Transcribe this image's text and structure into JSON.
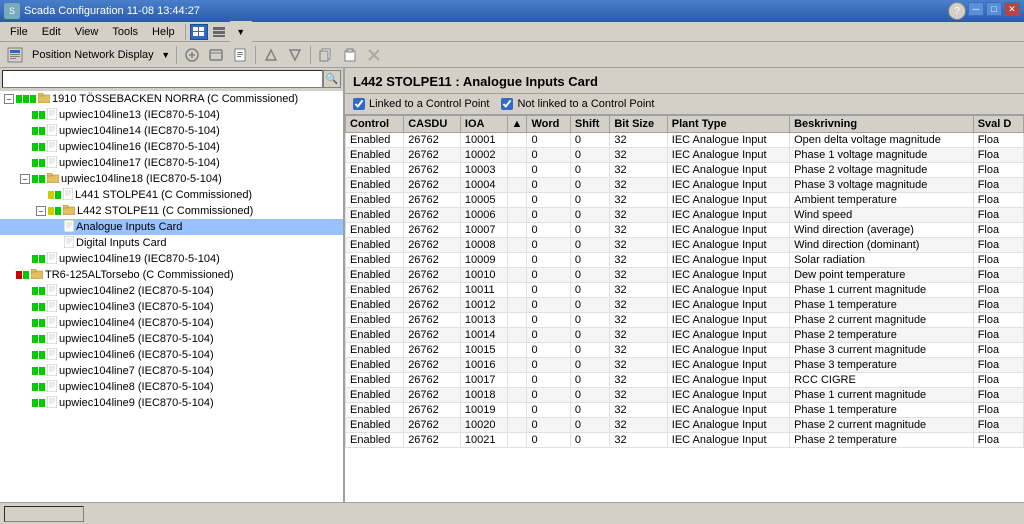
{
  "titleBar": {
    "title": "Scada Configuration  11-08 13:44:27",
    "icon": "S",
    "minimize": "─",
    "maximize": "□",
    "close": "✕",
    "help": "?"
  },
  "menuBar": {
    "items": [
      "File",
      "Edit",
      "View",
      "Tools",
      "Help"
    ]
  },
  "toolbar": {
    "networkDisplay": "Position Network Display",
    "dropdownArrow": "▼"
  },
  "leftPanel": {
    "searchPlaceholder": "",
    "treeItems": [
      {
        "level": 0,
        "label": "1910 TÖSSEBACKEN NORRA (C  Commissioned)",
        "hasExpand": true,
        "expanded": true,
        "dotColors": [
          "green",
          "green",
          "green"
        ],
        "id": "1910"
      },
      {
        "level": 1,
        "label": "upwiec104line13 (IEC870-5-104)",
        "hasExpand": false,
        "dotColors": [
          "green",
          "green"
        ],
        "id": "line13"
      },
      {
        "level": 1,
        "label": "upwiec104line14 (IEC870-5-104)",
        "hasExpand": false,
        "dotColors": [
          "green",
          "green"
        ],
        "id": "line14"
      },
      {
        "level": 1,
        "label": "upwiec104line16 (IEC870-5-104)",
        "hasExpand": false,
        "dotColors": [
          "green",
          "green"
        ],
        "id": "line16"
      },
      {
        "level": 1,
        "label": "upwiec104line17 (IEC870-5-104)",
        "hasExpand": false,
        "dotColors": [
          "green",
          "green"
        ],
        "id": "line17"
      },
      {
        "level": 1,
        "label": "upwiec104line18 (IEC870-5-104)",
        "hasExpand": true,
        "expanded": true,
        "dotColors": [
          "green",
          "green"
        ],
        "id": "line18"
      },
      {
        "level": 2,
        "label": "L441 STOLPE41 (C  Commissioned)",
        "hasExpand": false,
        "dotColors": [
          "yellow",
          "green"
        ],
        "id": "L441"
      },
      {
        "level": 2,
        "label": "L442 STOLPE11 (C  Commissioned)",
        "hasExpand": true,
        "expanded": true,
        "dotColors": [
          "yellow",
          "green"
        ],
        "id": "L442",
        "selected": false
      },
      {
        "level": 3,
        "label": "Analogue Inputs Card",
        "hasExpand": false,
        "dotColors": [],
        "id": "AnalogueInputs",
        "highlighted": true
      },
      {
        "level": 3,
        "label": "Digital Inputs Card",
        "hasExpand": false,
        "dotColors": [],
        "id": "DigitalInputs"
      },
      {
        "level": 1,
        "label": "upwiec104line19 (IEC870-5-104)",
        "hasExpand": false,
        "dotColors": [
          "green",
          "green"
        ],
        "id": "line19"
      },
      {
        "level": 0,
        "label": "TR6-125ALTorsebo (C  Commissioned)",
        "hasExpand": false,
        "dotColors": [
          "red",
          "green"
        ],
        "id": "TR6"
      },
      {
        "level": 1,
        "label": "upwiec104line2 (IEC870-5-104)",
        "hasExpand": false,
        "dotColors": [
          "green",
          "green"
        ],
        "id": "line2"
      },
      {
        "level": 1,
        "label": "upwiec104line3 (IEC870-5-104)",
        "hasExpand": false,
        "dotColors": [
          "green",
          "green"
        ],
        "id": "line3"
      },
      {
        "level": 1,
        "label": "upwiec104line4 (IEC870-5-104)",
        "hasExpand": false,
        "dotColors": [
          "green",
          "green"
        ],
        "id": "line4"
      },
      {
        "level": 1,
        "label": "upwiec104line5 (IEC870-5-104)",
        "hasExpand": false,
        "dotColors": [
          "green",
          "green"
        ],
        "id": "line5"
      },
      {
        "level": 1,
        "label": "upwiec104line6 (IEC870-5-104)",
        "hasExpand": false,
        "dotColors": [
          "green",
          "green"
        ],
        "id": "line6"
      },
      {
        "level": 1,
        "label": "upwiec104line7 (IEC870-5-104)",
        "hasExpand": false,
        "dotColors": [
          "green",
          "green"
        ],
        "id": "line7"
      },
      {
        "level": 1,
        "label": "upwiec104line8 (IEC870-5-104)",
        "hasExpand": false,
        "dotColors": [
          "green",
          "green"
        ],
        "id": "line8"
      },
      {
        "level": 1,
        "label": "upwiec104line9 (IEC870-5-104)",
        "hasExpand": false,
        "dotColors": [
          "green",
          "green"
        ],
        "id": "line9"
      }
    ]
  },
  "rightPanel": {
    "title": "L442 STOLPE11 : Analogue Inputs Card",
    "filters": [
      {
        "label": "Linked to a Control Point",
        "checked": true
      },
      {
        "label": "Not linked to a Control Point",
        "checked": true
      }
    ],
    "tableColumns": [
      "Control",
      "CASDU",
      "IOA",
      "▲",
      "Word",
      "Shift",
      "Bit Size",
      "Plant Type",
      "Beskrivning",
      "Sval D"
    ],
    "tableRows": [
      [
        "Enabled",
        "26762",
        "10001",
        "",
        "0",
        "0",
        "32",
        "IEC Analogue Input",
        "Open delta voltage magnitude",
        "Floa"
      ],
      [
        "Enabled",
        "26762",
        "10002",
        "",
        "0",
        "0",
        "32",
        "IEC Analogue Input",
        "Phase 1 voltage magnitude",
        "Floa"
      ],
      [
        "Enabled",
        "26762",
        "10003",
        "",
        "0",
        "0",
        "32",
        "IEC Analogue Input",
        "Phase 2 voltage magnitude",
        "Floa"
      ],
      [
        "Enabled",
        "26762",
        "10004",
        "",
        "0",
        "0",
        "32",
        "IEC Analogue Input",
        "Phase 3 voltage magnitude",
        "Floa"
      ],
      [
        "Enabled",
        "26762",
        "10005",
        "",
        "0",
        "0",
        "32",
        "IEC Analogue Input",
        "Ambient temperature",
        "Floa"
      ],
      [
        "Enabled",
        "26762",
        "10006",
        "",
        "0",
        "0",
        "32",
        "IEC Analogue Input",
        "Wind speed",
        "Floa"
      ],
      [
        "Enabled",
        "26762",
        "10007",
        "",
        "0",
        "0",
        "32",
        "IEC Analogue Input",
        "Wind direction (average)",
        "Floa"
      ],
      [
        "Enabled",
        "26762",
        "10008",
        "",
        "0",
        "0",
        "32",
        "IEC Analogue Input",
        "Wind direction (dominant)",
        "Floa"
      ],
      [
        "Enabled",
        "26762",
        "10009",
        "",
        "0",
        "0",
        "32",
        "IEC Analogue Input",
        "Solar radiation",
        "Floa"
      ],
      [
        "Enabled",
        "26762",
        "10010",
        "",
        "0",
        "0",
        "32",
        "IEC Analogue Input",
        "Dew point temperature",
        "Floa"
      ],
      [
        "Enabled",
        "26762",
        "10011",
        "",
        "0",
        "0",
        "32",
        "IEC Analogue Input",
        "Phase 1 current magnitude",
        "Floa"
      ],
      [
        "Enabled",
        "26762",
        "10012",
        "",
        "0",
        "0",
        "32",
        "IEC Analogue Input",
        "Phase 1 temperature",
        "Floa"
      ],
      [
        "Enabled",
        "26762",
        "10013",
        "",
        "0",
        "0",
        "32",
        "IEC Analogue Input",
        "Phase 2 current magnitude",
        "Floa"
      ],
      [
        "Enabled",
        "26762",
        "10014",
        "",
        "0",
        "0",
        "32",
        "IEC Analogue Input",
        "Phase 2 temperature",
        "Floa"
      ],
      [
        "Enabled",
        "26762",
        "10015",
        "",
        "0",
        "0",
        "32",
        "IEC Analogue Input",
        "Phase 3 current magnitude",
        "Floa"
      ],
      [
        "Enabled",
        "26762",
        "10016",
        "",
        "0",
        "0",
        "32",
        "IEC Analogue Input",
        "Phase 3 temperature",
        "Floa"
      ],
      [
        "Enabled",
        "26762",
        "10017",
        "",
        "0",
        "0",
        "32",
        "IEC Analogue Input",
        "RCC CIGRE",
        "Floa"
      ],
      [
        "Enabled",
        "26762",
        "10018",
        "",
        "0",
        "0",
        "32",
        "IEC Analogue Input",
        "Phase 1 current magnitude",
        "Floa"
      ],
      [
        "Enabled",
        "26762",
        "10019",
        "",
        "0",
        "0",
        "32",
        "IEC Analogue Input",
        "Phase 1 temperature",
        "Floa"
      ],
      [
        "Enabled",
        "26762",
        "10020",
        "",
        "0",
        "0",
        "32",
        "IEC Analogue Input",
        "Phase 2 current magnitude",
        "Floa"
      ],
      [
        "Enabled",
        "26762",
        "10021",
        "",
        "0",
        "0",
        "32",
        "IEC Analogue Input",
        "Phase 2 temperature",
        "Floa"
      ]
    ]
  },
  "statusBar": {
    "text": ""
  }
}
